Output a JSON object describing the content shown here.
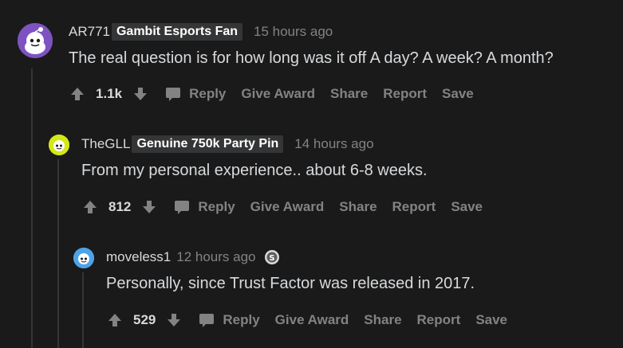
{
  "comments": [
    {
      "username": "AR771",
      "flair": "Gambit Esports Fan",
      "timestamp": "15 hours ago",
      "body": "The real question is for how long was it off A day? A week? A month?",
      "score": "1.1k",
      "actions": {
        "reply": "Reply",
        "give_award": "Give Award",
        "share": "Share",
        "report": "Report",
        "save": "Save"
      }
    },
    {
      "username": "TheGLL",
      "flair": "Genuine 750k Party Pin",
      "timestamp": "14 hours ago",
      "body": "From my personal experience.. about 6-8 weeks.",
      "score": "812",
      "actions": {
        "reply": "Reply",
        "give_award": "Give Award",
        "share": "Share",
        "report": "Report",
        "save": "Save"
      }
    },
    {
      "username": "moveless1",
      "timestamp": "12 hours ago",
      "body": "Personally, since Trust Factor was released in 2017.",
      "score": "529",
      "actions": {
        "reply": "Reply",
        "give_award": "Give Award",
        "share": "Share",
        "report": "Report",
        "save": "Save"
      }
    }
  ],
  "icons": {
    "upvote": "arrow-up-icon",
    "downvote": "arrow-down-icon",
    "reply": "speech-bubble-icon",
    "badge": "silver-award-icon"
  },
  "colors": {
    "background": "#1a1a1b",
    "text": "#d7dadc",
    "muted": "#818384",
    "flair_bg": "#343536",
    "thread_line": "#343536"
  }
}
